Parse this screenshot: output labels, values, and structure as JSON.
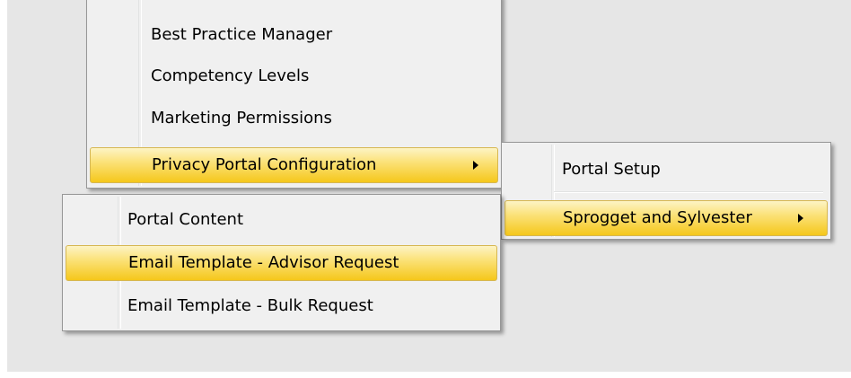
{
  "main_menu": {
    "items": [
      {
        "label": "Best Practice Manager"
      },
      {
        "label": "Competency Levels"
      },
      {
        "label": "Marketing Permissions"
      },
      {
        "label": "Privacy Portal Configuration",
        "has_submenu": true,
        "highlighted": true
      }
    ]
  },
  "privacy_submenu": {
    "items": [
      {
        "label": "Portal Setup"
      },
      {
        "label": "Sprogget and Sylvester",
        "has_submenu": true,
        "highlighted": true
      }
    ]
  },
  "sprogget_submenu": {
    "items": [
      {
        "label": "Portal Content"
      },
      {
        "label": "Email Template - Advisor Request",
        "highlighted": true
      },
      {
        "label": "Email Template - Bulk Request"
      }
    ]
  },
  "colors": {
    "menu_background": "#f0f0f0",
    "menu_border": "#979797",
    "highlight_top": "#fdf4c5",
    "highlight_bottom": "#f5c71b",
    "highlight_border": "#d6b752",
    "desktop_background": "#e6e6e6"
  },
  "icons": [
    "submenu-arrow-icon"
  ]
}
